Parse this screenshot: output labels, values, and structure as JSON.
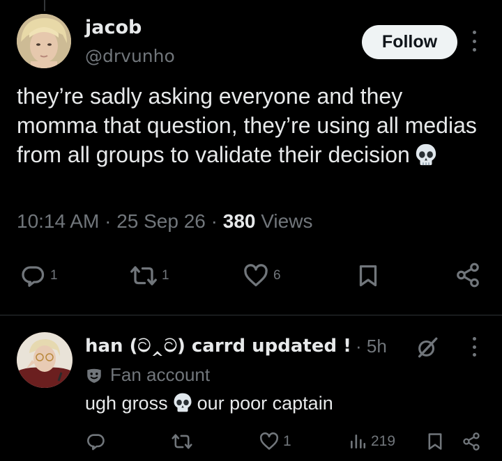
{
  "tweet": {
    "author_name": "jacob",
    "author_handle": "@drvunho",
    "follow_label": "Follow",
    "text": "they’re sadly asking everyone and they momma that question, they’re using all medias from all groups to validate their decision",
    "time": "10:14 AM",
    "date": "25 Sep 26",
    "views_count": "380",
    "views_label": "Views",
    "separator": "·",
    "replies": "1",
    "reposts": "1",
    "likes": "6"
  },
  "reply": {
    "author_name": "han (ට‸ට) carrd updated !",
    "time": "5h",
    "time_separator": "·",
    "badge_label": "Fan account",
    "text_before": "ugh gross",
    "text_after": "our poor captain",
    "likes": "1",
    "views": "219"
  },
  "colors": {
    "background": "#000000",
    "text": "#e7e9ea",
    "muted": "#71767b",
    "follow_bg": "#eff3f4"
  },
  "icons": [
    "skull-emoji",
    "reply-icon",
    "repost-icon",
    "like-icon",
    "bookmark-icon",
    "share-icon",
    "views-icon",
    "grok-icon",
    "fan-account-icon",
    "more-icon"
  ]
}
